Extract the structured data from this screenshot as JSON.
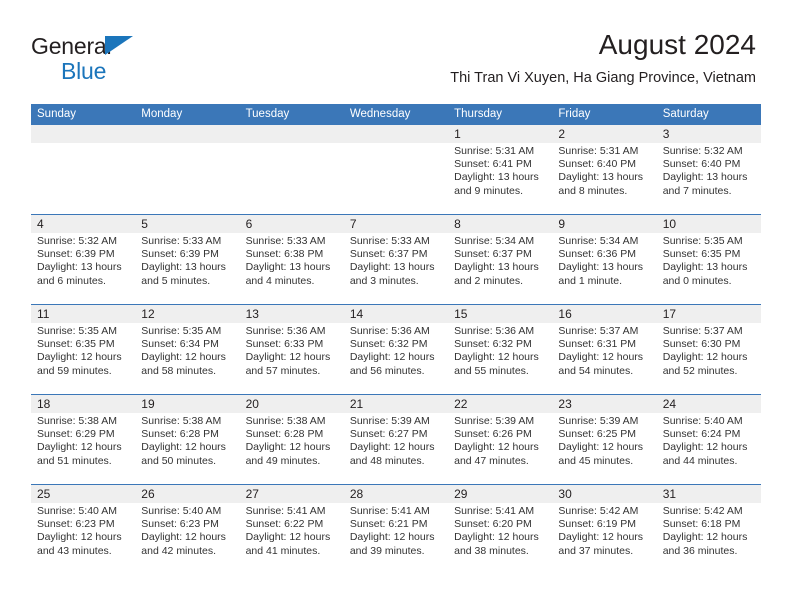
{
  "brand": {
    "word1": "General",
    "word2": "Blue",
    "triangle_color": "#1b75bb"
  },
  "header": {
    "title": "August 2024",
    "subtitle": "Thi Tran Vi Xuyen, Ha Giang Province, Vietnam",
    "accent_color": "#3b77b8",
    "datebar_color": "#efefef"
  },
  "calendar": {
    "weekday_headers": [
      "Sunday",
      "Monday",
      "Tuesday",
      "Wednesday",
      "Thursday",
      "Friday",
      "Saturday"
    ],
    "weeks": [
      [
        {
          "day": "",
          "sunrise": "",
          "sunset": "",
          "daylight1": "",
          "daylight2": ""
        },
        {
          "day": "",
          "sunrise": "",
          "sunset": "",
          "daylight1": "",
          "daylight2": ""
        },
        {
          "day": "",
          "sunrise": "",
          "sunset": "",
          "daylight1": "",
          "daylight2": ""
        },
        {
          "day": "",
          "sunrise": "",
          "sunset": "",
          "daylight1": "",
          "daylight2": ""
        },
        {
          "day": "1",
          "sunrise": "Sunrise: 5:31 AM",
          "sunset": "Sunset: 6:41 PM",
          "daylight1": "Daylight: 13 hours",
          "daylight2": "and 9 minutes."
        },
        {
          "day": "2",
          "sunrise": "Sunrise: 5:31 AM",
          "sunset": "Sunset: 6:40 PM",
          "daylight1": "Daylight: 13 hours",
          "daylight2": "and 8 minutes."
        },
        {
          "day": "3",
          "sunrise": "Sunrise: 5:32 AM",
          "sunset": "Sunset: 6:40 PM",
          "daylight1": "Daylight: 13 hours",
          "daylight2": "and 7 minutes."
        }
      ],
      [
        {
          "day": "4",
          "sunrise": "Sunrise: 5:32 AM",
          "sunset": "Sunset: 6:39 PM",
          "daylight1": "Daylight: 13 hours",
          "daylight2": "and 6 minutes."
        },
        {
          "day": "5",
          "sunrise": "Sunrise: 5:33 AM",
          "sunset": "Sunset: 6:39 PM",
          "daylight1": "Daylight: 13 hours",
          "daylight2": "and 5 minutes."
        },
        {
          "day": "6",
          "sunrise": "Sunrise: 5:33 AM",
          "sunset": "Sunset: 6:38 PM",
          "daylight1": "Daylight: 13 hours",
          "daylight2": "and 4 minutes."
        },
        {
          "day": "7",
          "sunrise": "Sunrise: 5:33 AM",
          "sunset": "Sunset: 6:37 PM",
          "daylight1": "Daylight: 13 hours",
          "daylight2": "and 3 minutes."
        },
        {
          "day": "8",
          "sunrise": "Sunrise: 5:34 AM",
          "sunset": "Sunset: 6:37 PM",
          "daylight1": "Daylight: 13 hours",
          "daylight2": "and 2 minutes."
        },
        {
          "day": "9",
          "sunrise": "Sunrise: 5:34 AM",
          "sunset": "Sunset: 6:36 PM",
          "daylight1": "Daylight: 13 hours",
          "daylight2": "and 1 minute."
        },
        {
          "day": "10",
          "sunrise": "Sunrise: 5:35 AM",
          "sunset": "Sunset: 6:35 PM",
          "daylight1": "Daylight: 13 hours",
          "daylight2": "and 0 minutes."
        }
      ],
      [
        {
          "day": "11",
          "sunrise": "Sunrise: 5:35 AM",
          "sunset": "Sunset: 6:35 PM",
          "daylight1": "Daylight: 12 hours",
          "daylight2": "and 59 minutes."
        },
        {
          "day": "12",
          "sunrise": "Sunrise: 5:35 AM",
          "sunset": "Sunset: 6:34 PM",
          "daylight1": "Daylight: 12 hours",
          "daylight2": "and 58 minutes."
        },
        {
          "day": "13",
          "sunrise": "Sunrise: 5:36 AM",
          "sunset": "Sunset: 6:33 PM",
          "daylight1": "Daylight: 12 hours",
          "daylight2": "and 57 minutes."
        },
        {
          "day": "14",
          "sunrise": "Sunrise: 5:36 AM",
          "sunset": "Sunset: 6:32 PM",
          "daylight1": "Daylight: 12 hours",
          "daylight2": "and 56 minutes."
        },
        {
          "day": "15",
          "sunrise": "Sunrise: 5:36 AM",
          "sunset": "Sunset: 6:32 PM",
          "daylight1": "Daylight: 12 hours",
          "daylight2": "and 55 minutes."
        },
        {
          "day": "16",
          "sunrise": "Sunrise: 5:37 AM",
          "sunset": "Sunset: 6:31 PM",
          "daylight1": "Daylight: 12 hours",
          "daylight2": "and 54 minutes."
        },
        {
          "day": "17",
          "sunrise": "Sunrise: 5:37 AM",
          "sunset": "Sunset: 6:30 PM",
          "daylight1": "Daylight: 12 hours",
          "daylight2": "and 52 minutes."
        }
      ],
      [
        {
          "day": "18",
          "sunrise": "Sunrise: 5:38 AM",
          "sunset": "Sunset: 6:29 PM",
          "daylight1": "Daylight: 12 hours",
          "daylight2": "and 51 minutes."
        },
        {
          "day": "19",
          "sunrise": "Sunrise: 5:38 AM",
          "sunset": "Sunset: 6:28 PM",
          "daylight1": "Daylight: 12 hours",
          "daylight2": "and 50 minutes."
        },
        {
          "day": "20",
          "sunrise": "Sunrise: 5:38 AM",
          "sunset": "Sunset: 6:28 PM",
          "daylight1": "Daylight: 12 hours",
          "daylight2": "and 49 minutes."
        },
        {
          "day": "21",
          "sunrise": "Sunrise: 5:39 AM",
          "sunset": "Sunset: 6:27 PM",
          "daylight1": "Daylight: 12 hours",
          "daylight2": "and 48 minutes."
        },
        {
          "day": "22",
          "sunrise": "Sunrise: 5:39 AM",
          "sunset": "Sunset: 6:26 PM",
          "daylight1": "Daylight: 12 hours",
          "daylight2": "and 47 minutes."
        },
        {
          "day": "23",
          "sunrise": "Sunrise: 5:39 AM",
          "sunset": "Sunset: 6:25 PM",
          "daylight1": "Daylight: 12 hours",
          "daylight2": "and 45 minutes."
        },
        {
          "day": "24",
          "sunrise": "Sunrise: 5:40 AM",
          "sunset": "Sunset: 6:24 PM",
          "daylight1": "Daylight: 12 hours",
          "daylight2": "and 44 minutes."
        }
      ],
      [
        {
          "day": "25",
          "sunrise": "Sunrise: 5:40 AM",
          "sunset": "Sunset: 6:23 PM",
          "daylight1": "Daylight: 12 hours",
          "daylight2": "and 43 minutes."
        },
        {
          "day": "26",
          "sunrise": "Sunrise: 5:40 AM",
          "sunset": "Sunset: 6:23 PM",
          "daylight1": "Daylight: 12 hours",
          "daylight2": "and 42 minutes."
        },
        {
          "day": "27",
          "sunrise": "Sunrise: 5:41 AM",
          "sunset": "Sunset: 6:22 PM",
          "daylight1": "Daylight: 12 hours",
          "daylight2": "and 41 minutes."
        },
        {
          "day": "28",
          "sunrise": "Sunrise: 5:41 AM",
          "sunset": "Sunset: 6:21 PM",
          "daylight1": "Daylight: 12 hours",
          "daylight2": "and 39 minutes."
        },
        {
          "day": "29",
          "sunrise": "Sunrise: 5:41 AM",
          "sunset": "Sunset: 6:20 PM",
          "daylight1": "Daylight: 12 hours",
          "daylight2": "and 38 minutes."
        },
        {
          "day": "30",
          "sunrise": "Sunrise: 5:42 AM",
          "sunset": "Sunset: 6:19 PM",
          "daylight1": "Daylight: 12 hours",
          "daylight2": "and 37 minutes."
        },
        {
          "day": "31",
          "sunrise": "Sunrise: 5:42 AM",
          "sunset": "Sunset: 6:18 PM",
          "daylight1": "Daylight: 12 hours",
          "daylight2": "and 36 minutes."
        }
      ]
    ]
  }
}
